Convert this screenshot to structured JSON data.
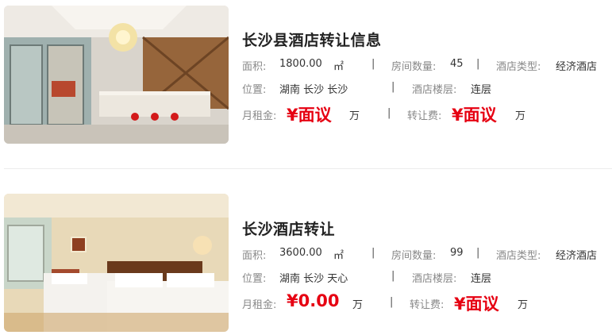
{
  "listings": [
    {
      "title": "长沙县酒店转让信息",
      "area_label": "面积:",
      "area_value": "1800.00",
      "area_unit": "㎡",
      "rooms_label": "房间数量:",
      "rooms_value": "45",
      "type_label": "酒店类型:",
      "type_value": "经济酒店",
      "location_label": "位置:",
      "location_value": "湖南 长沙 长沙",
      "floor_label": "酒店楼层:",
      "floor_value": "连层",
      "rent_label": "月租金:",
      "rent_value": "¥面议",
      "rent_unit": "万",
      "fee_label": "转让费:",
      "fee_value": "¥面议",
      "fee_unit": "万",
      "separator": "|"
    },
    {
      "title": "长沙酒店转让",
      "area_label": "面积:",
      "area_value": "3600.00",
      "area_unit": "㎡",
      "rooms_label": "房间数量:",
      "rooms_value": "99",
      "type_label": "酒店类型:",
      "type_value": "经济酒店",
      "location_label": "位置:",
      "location_value": "湖南 长沙 天心",
      "floor_label": "酒店楼层:",
      "floor_value": "连层",
      "rent_label": "月租金:",
      "rent_value": "¥0.00",
      "rent_unit": "万",
      "fee_label": "转让费:",
      "fee_value": "¥面议",
      "fee_unit": "万",
      "separator": "|"
    }
  ]
}
